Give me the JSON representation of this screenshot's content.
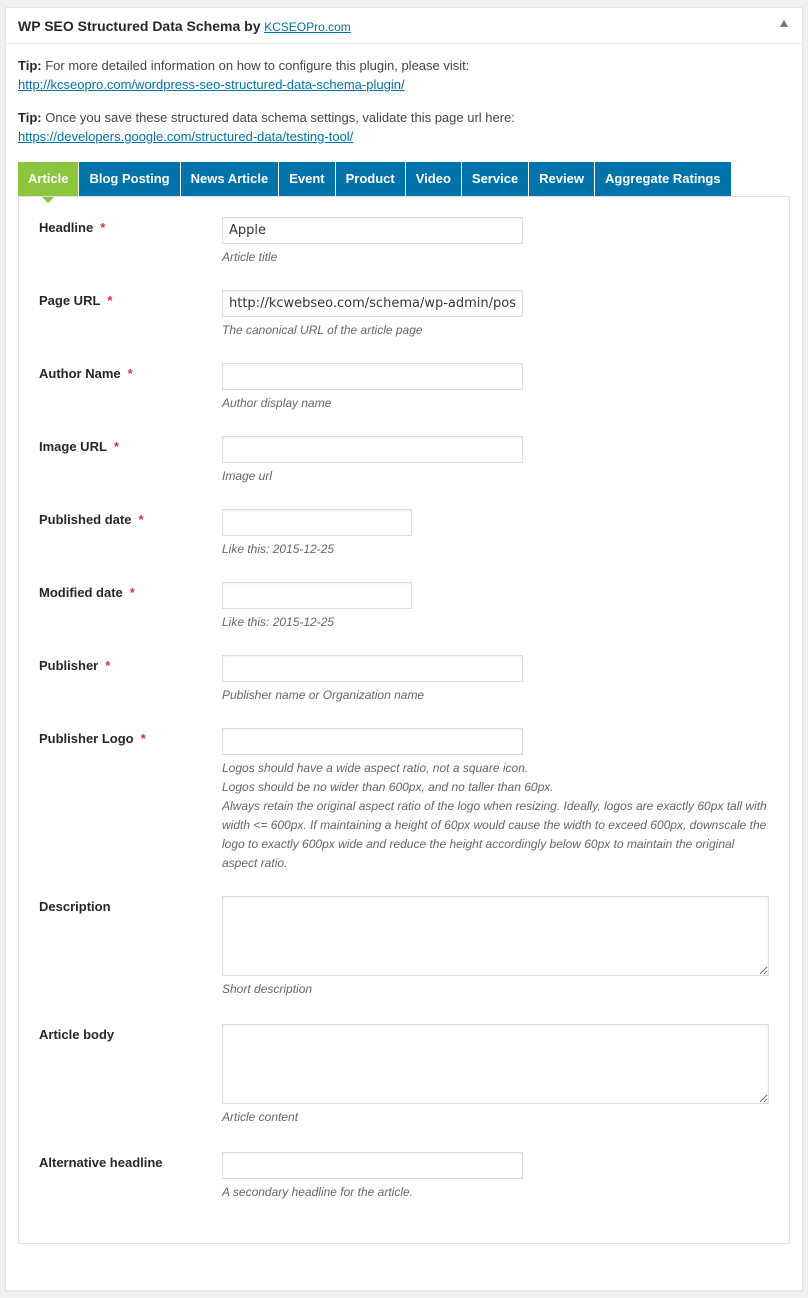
{
  "header": {
    "title": "WP SEO Structured Data Schema by",
    "link": "KCSEOPro.com",
    "toggle_icon": "triangle-up-icon"
  },
  "tips": [
    {
      "label": "Tip:",
      "text": " For more detailed information on how to configure this plugin, please visit:",
      "url": "http://kcseopro.com/wordpress-seo-structured-data-schema-plugin/"
    },
    {
      "label": "Tip:",
      "text": " Once you save these structured data schema settings, validate this page url here:",
      "url": "https://developers.google.com/structured-data/testing-tool/"
    }
  ],
  "tabs": [
    {
      "label": "Article",
      "active": true
    },
    {
      "label": "Blog Posting"
    },
    {
      "label": "News Article"
    },
    {
      "label": "Event"
    },
    {
      "label": "Product"
    },
    {
      "label": "Video"
    },
    {
      "label": "Service"
    },
    {
      "label": "Review"
    },
    {
      "label": "Aggregate Ratings"
    }
  ],
  "accent_colors": {
    "active_tab": "#8cc63e",
    "tab": "#0073aa",
    "required": "#dc3232"
  },
  "fields": {
    "headline": {
      "label": "Headline",
      "required": "*",
      "value": "Apple",
      "desc": "Article title"
    },
    "page_url": {
      "label": "Page URL",
      "required": "*",
      "value": "http://kcwebseo.com/schema/wp-admin/post.php",
      "desc": "The canonical URL of the article page"
    },
    "author_name": {
      "label": "Author Name",
      "required": "*",
      "value": "",
      "desc": "Author display name"
    },
    "image_url": {
      "label": "Image URL",
      "required": "*",
      "value": "",
      "desc": "Image url"
    },
    "published_date": {
      "label": "Published date",
      "required": "*",
      "value": "",
      "desc": "Like this: 2015-12-25"
    },
    "modified_date": {
      "label": "Modified date",
      "required": "*",
      "value": "",
      "desc": "Like this: 2015-12-25"
    },
    "publisher": {
      "label": "Publisher",
      "required": "*",
      "value": "",
      "desc": "Publisher name or Organization name"
    },
    "publisher_logo": {
      "label": "Publisher Logo",
      "required": "*",
      "value": "",
      "desc": [
        "Logos should have a wide aspect ratio, not a square icon.",
        "Logos should be no wider than 600px, and no taller than 60px.",
        "Always retain the original aspect ratio of the logo when resizing. Ideally, logos are exactly 60px tall with width <= 600px. If maintaining a height of 60px would cause the width to exceed 600px, downscale the logo to exactly 600px wide and reduce the height accordingly below 60px to maintain the original aspect ratio."
      ]
    },
    "description": {
      "label": "Description",
      "value": "",
      "desc": "Short description"
    },
    "article_body": {
      "label": "Article body",
      "value": "",
      "desc": "Article content"
    },
    "alternative_headline": {
      "label": "Alternative headline",
      "value": "",
      "desc": "A secondary headline for the article."
    }
  }
}
